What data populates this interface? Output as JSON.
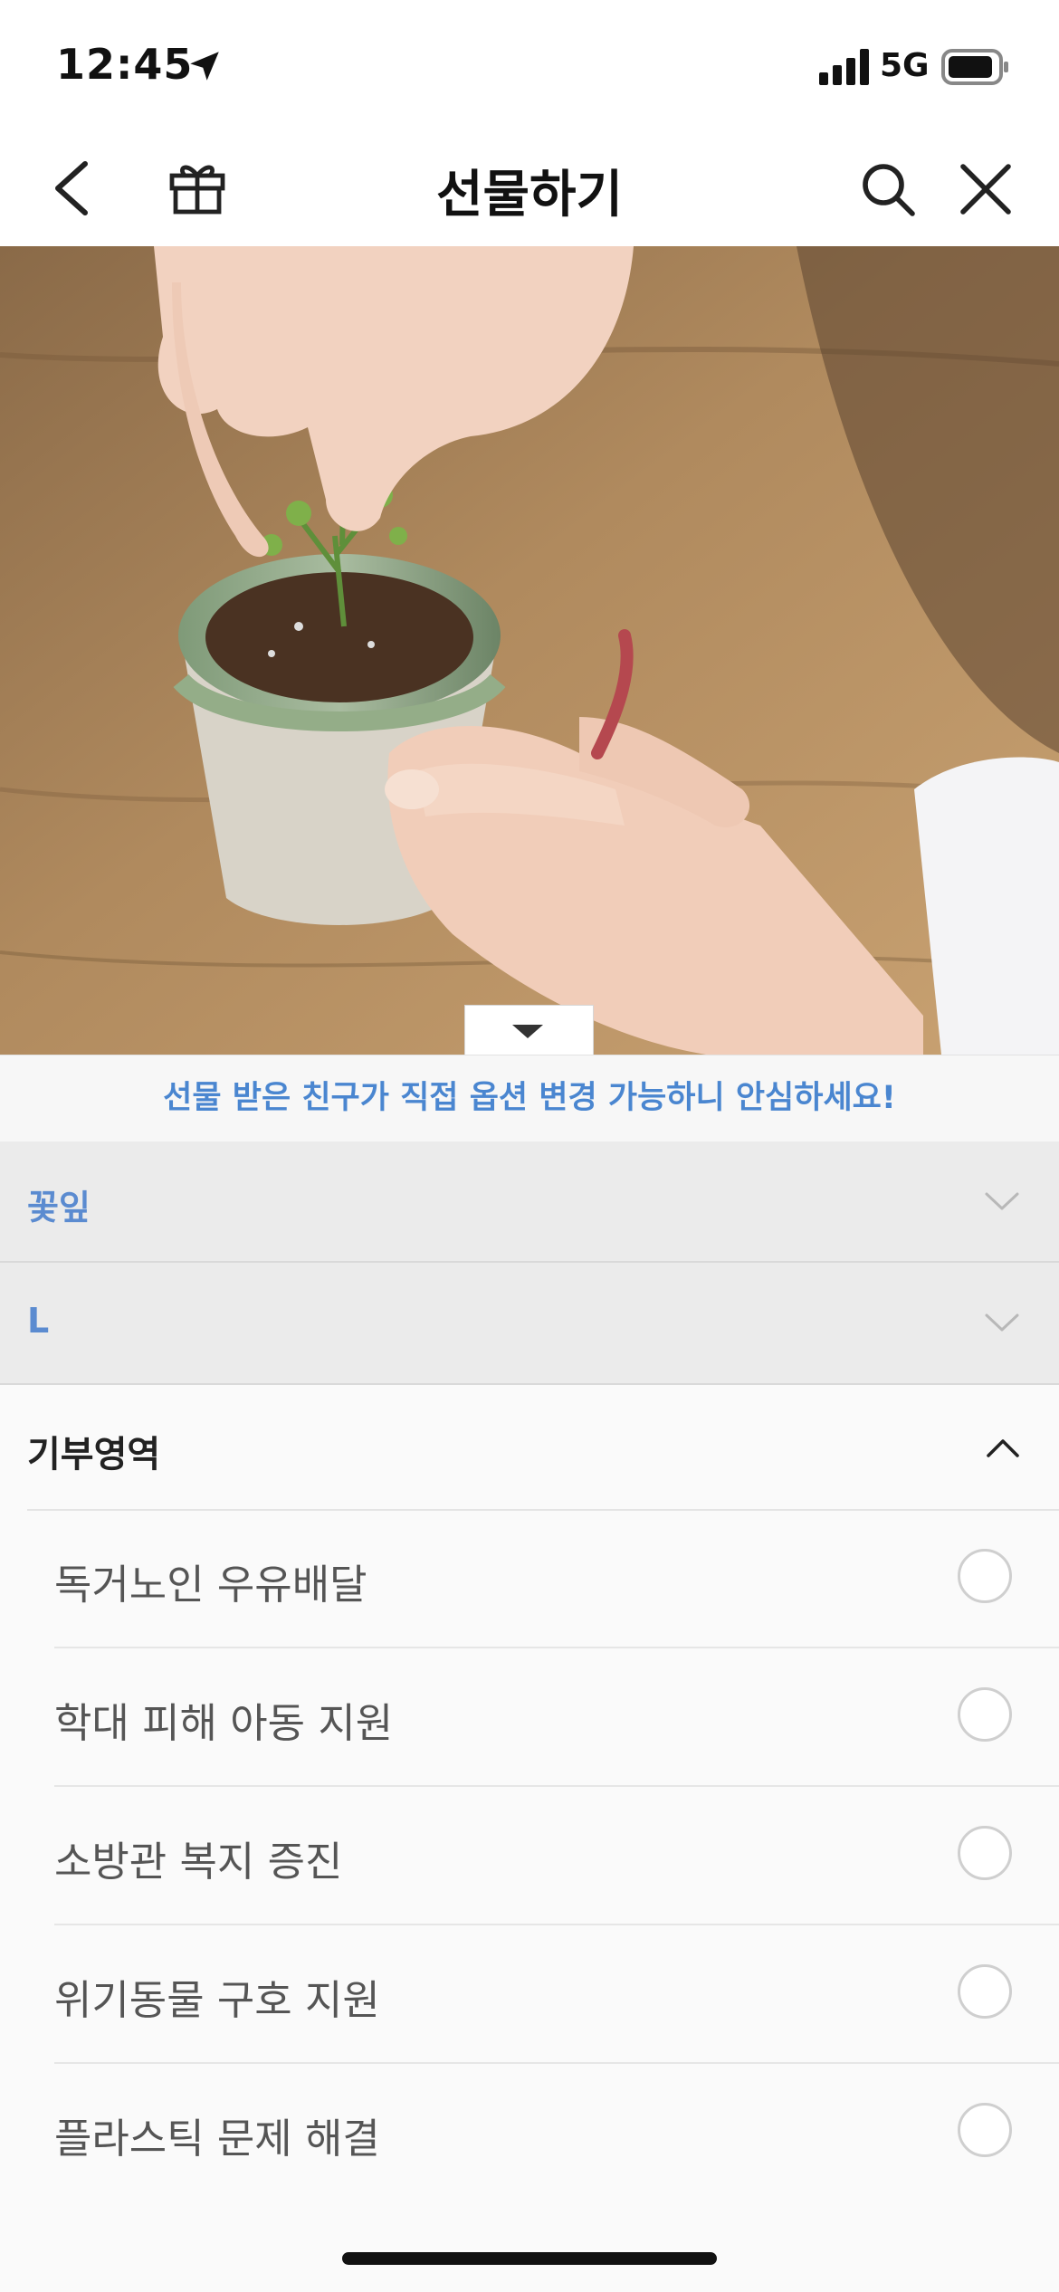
{
  "status_bar": {
    "time": "12:45",
    "network": "5G"
  },
  "nav": {
    "title": "선물하기"
  },
  "notice": "선물 받은 친구가 직접 옵션 변경 가능하니 안심하세요!",
  "options": [
    {
      "value": "꽃잎"
    },
    {
      "value": "L"
    }
  ],
  "donation": {
    "title": "기부영역",
    "items": [
      {
        "label": "독거노인 우유배달",
        "selected": false
      },
      {
        "label": "학대 피해 아동 지원",
        "selected": false
      },
      {
        "label": "소방관 복지 증진",
        "selected": false
      },
      {
        "label": "위기동물 구호 지원",
        "selected": false
      },
      {
        "label": "플라스틱 문제 해결",
        "selected": false
      }
    ]
  },
  "colors": {
    "accent": "#5b8bd0",
    "notice_text": "#4a86d0"
  }
}
